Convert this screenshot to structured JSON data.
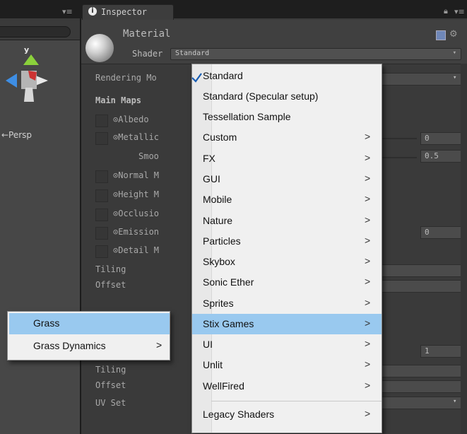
{
  "inspector": {
    "tab_title": "Inspector",
    "material_title": "Material",
    "shader_label": "Shader",
    "shader_value": "Standard"
  },
  "scene": {
    "axis_label": "y",
    "persp_label": "←Persp"
  },
  "properties": {
    "rendering_mode": "Rendering Mo",
    "main_maps": "Main Maps",
    "albedo": "⊙Albedo",
    "metallic": "⊙Metallic",
    "smoothness": "Smoo",
    "normal": "⊙Normal M",
    "height": "⊙Height M",
    "occlusion": "⊙Occlusio",
    "emission": "⊙Emission",
    "detail": "⊙Detail M",
    "tiling": "Tiling",
    "offset": "Offset",
    "tiling2": "Tiling",
    "offset2": "Offset",
    "uv_set": "UV Set",
    "metallic_value": "0",
    "smooth_value": "0.5",
    "emission_value": "0",
    "detail_value": "1"
  },
  "shader_menu": {
    "items": [
      {
        "label": "Standard",
        "checked": true,
        "submenu": false
      },
      {
        "label": "Standard (Specular setup)",
        "submenu": false
      },
      {
        "label": "Tessellation Sample",
        "submenu": false
      },
      {
        "label": "Custom",
        "submenu": true
      },
      {
        "label": "FX",
        "submenu": true
      },
      {
        "label": "GUI",
        "submenu": true
      },
      {
        "label": "Mobile",
        "submenu": true
      },
      {
        "label": "Nature",
        "submenu": true
      },
      {
        "label": "Particles",
        "submenu": true
      },
      {
        "label": "Skybox",
        "submenu": true
      },
      {
        "label": "Sonic Ether",
        "submenu": true
      },
      {
        "label": "Sprites",
        "submenu": true
      },
      {
        "label": "Stix Games",
        "submenu": true,
        "highlighted": true
      },
      {
        "label": "UI",
        "submenu": true
      },
      {
        "label": "Unlit",
        "submenu": true
      },
      {
        "label": "WellFired",
        "submenu": true
      },
      {
        "label": "Legacy Shaders",
        "submenu": true
      }
    ]
  },
  "sub_menu": {
    "items": [
      {
        "label": "Grass",
        "highlighted": true
      },
      {
        "label": "Grass Dynamics",
        "submenu": true
      }
    ]
  },
  "submenu_arrow": ">",
  "colors": {
    "highlight": "#99c9ef",
    "menu_bg": "#f0f0f0",
    "panel_bg": "#3a3a3a"
  }
}
